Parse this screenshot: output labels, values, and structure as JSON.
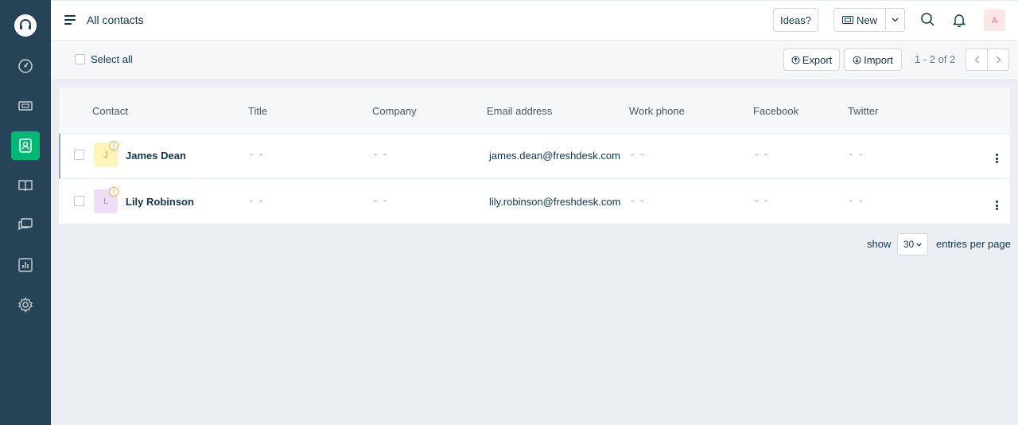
{
  "header": {
    "title": "All contacts",
    "ideas_label": "Ideas?",
    "new_label": "New",
    "avatar_initial": "A"
  },
  "sidebar": {
    "items": [
      {
        "icon": "dashboard-icon"
      },
      {
        "icon": "tickets-icon"
      },
      {
        "icon": "contacts-icon",
        "active": true
      },
      {
        "icon": "solutions-icon"
      },
      {
        "icon": "forums-icon"
      },
      {
        "icon": "reports-icon"
      },
      {
        "icon": "admin-gear-icon"
      }
    ]
  },
  "toolbar": {
    "select_all_label": "Select all",
    "export_label": "Export",
    "import_label": "Import",
    "pager_text": "1 - 2 of 2"
  },
  "table": {
    "columns": [
      "Contact",
      "Title",
      "Company",
      "Email address",
      "Work phone",
      "Facebook",
      "Twitter"
    ],
    "rows": [
      {
        "initial": "J",
        "name": "James Dean",
        "title": "- -",
        "company": "- -",
        "email": "james.dean@freshdesk.com",
        "work_phone": "- -",
        "facebook": "- -",
        "twitter": "- -",
        "avatar_bg": "#fdf5b8",
        "avatar_fg": "#c9a93a"
      },
      {
        "initial": "L",
        "name": "Lily Robinson",
        "title": "- -",
        "company": "- -",
        "email": "lily.robinson@freshdesk.com",
        "work_phone": "- -",
        "facebook": "- -",
        "twitter": "- -",
        "avatar_bg": "#efdcf7",
        "avatar_fg": "#a98bb7"
      }
    ]
  },
  "pagination": {
    "show_label": "show",
    "per_page": "30",
    "entries_label": "entries per page"
  },
  "colors": {
    "sidebar_bg": "#264357",
    "active_nav": "#02b875",
    "warning": "#f0b14c"
  }
}
